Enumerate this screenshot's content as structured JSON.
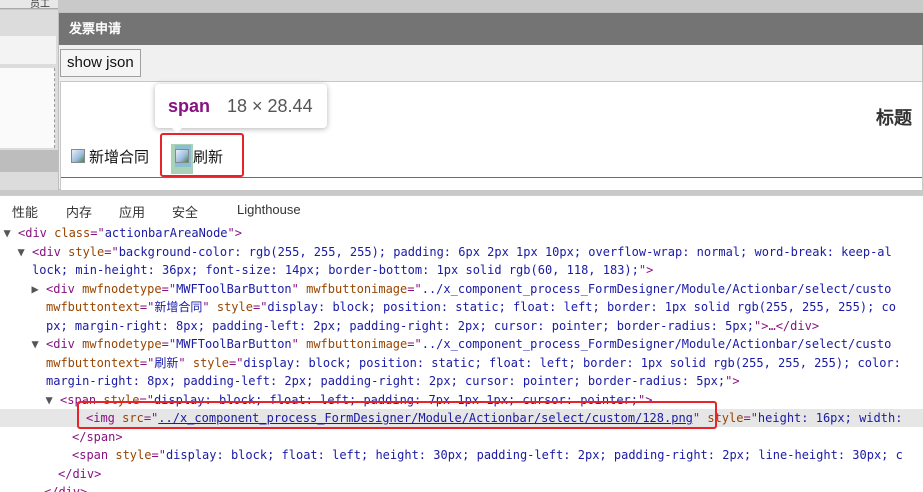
{
  "background": {
    "top_tab_label": "员工"
  },
  "dialog": {
    "title": "发票申请",
    "show_json_label": "show json",
    "form_title": "标题",
    "toolbar": {
      "add_contract_label": "新增合同",
      "refresh_label": "刷新"
    }
  },
  "tooltip": {
    "tag": "span",
    "size": "18 × 28.44"
  },
  "devtools": {
    "tabs": [
      "性能",
      "内存",
      "应用",
      "安全",
      "Lighthouse"
    ],
    "lines": [
      {
        "indent": 18,
        "tri": "▼",
        "parts": [
          [
            "tg",
            "<div "
          ],
          [
            "an",
            "class"
          ],
          [
            "tg",
            "=\""
          ],
          [
            "av",
            "actionbarAreaNode"
          ],
          [
            "tg",
            "\">"
          ]
        ]
      },
      {
        "indent": 32,
        "tri": "▼",
        "parts": [
          [
            "tg",
            "<div "
          ],
          [
            "an",
            "style"
          ],
          [
            "tg",
            "=\""
          ],
          [
            "av",
            "background-color: rgb(255, 255, 255); padding: 6px 2px 1px 10px; overflow-wrap: normal; word-break: keep-al"
          ]
        ]
      },
      {
        "indent": 32,
        "tri": "",
        "parts": [
          [
            "av",
            "lock; min-height: 36px; font-size: 14px; border-bottom: 1px solid rgb(60, 118, 183);"
          ],
          [
            "tg",
            "\">"
          ]
        ]
      },
      {
        "indent": 46,
        "tri": "▶",
        "parts": [
          [
            "tg",
            "<div "
          ],
          [
            "an",
            "mwfnodetype"
          ],
          [
            "tg",
            "=\""
          ],
          [
            "av",
            "MWFToolBarButton"
          ],
          [
            "tg",
            "\" "
          ],
          [
            "an",
            "mwfbuttonimage"
          ],
          [
            "tg",
            "=\""
          ],
          [
            "av",
            "../x_component_process_FormDesigner/Module/Actionbar/select/custo"
          ]
        ]
      },
      {
        "indent": 46,
        "tri": "",
        "parts": [
          [
            "an",
            "mwfbuttontext"
          ],
          [
            "tg",
            "=\""
          ],
          [
            "av",
            "新增合同"
          ],
          [
            "tg",
            "\" "
          ],
          [
            "an",
            "style"
          ],
          [
            "tg",
            "=\""
          ],
          [
            "av",
            "display: block; position: static; float: left; border: 1px solid rgb(255, 255, 255); co"
          ]
        ]
      },
      {
        "indent": 46,
        "tri": "",
        "parts": [
          [
            "av",
            "px; margin-right: 8px; padding-left: 2px; padding-right: 2px; cursor: pointer; border-radius: 5px;"
          ],
          [
            "tg",
            "\">…</div>"
          ]
        ]
      },
      {
        "indent": 46,
        "tri": "▼",
        "parts": [
          [
            "tg",
            "<div "
          ],
          [
            "an",
            "mwfnodetype"
          ],
          [
            "tg",
            "=\""
          ],
          [
            "av",
            "MWFToolBarButton"
          ],
          [
            "tg",
            "\" "
          ],
          [
            "an",
            "mwfbuttonimage"
          ],
          [
            "tg",
            "=\""
          ],
          [
            "av",
            "../x_component_process_FormDesigner/Module/Actionbar/select/custo"
          ]
        ]
      },
      {
        "indent": 46,
        "tri": "",
        "parts": [
          [
            "an",
            "mwfbuttontext"
          ],
          [
            "tg",
            "=\""
          ],
          [
            "av",
            "刷新"
          ],
          [
            "tg",
            "\" "
          ],
          [
            "an",
            "style"
          ],
          [
            "tg",
            "=\""
          ],
          [
            "av",
            "display: block; position: static; float: left; border: 1px solid rgb(255, 255, 255); color:"
          ]
        ]
      },
      {
        "indent": 46,
        "tri": "",
        "parts": [
          [
            "av",
            "margin-right: 8px; padding-left: 2px; padding-right: 2px; cursor: pointer; border-radius: 5px;"
          ],
          [
            "tg",
            "\">"
          ]
        ]
      },
      {
        "indent": 60,
        "tri": "▼",
        "parts": [
          [
            "tg",
            "<span "
          ],
          [
            "an",
            "style"
          ],
          [
            "tg",
            "=\""
          ],
          [
            "av",
            "display: block; float: left; padding: 7px 1px 1px; cursor: pointer;"
          ],
          [
            "tg",
            "\">"
          ]
        ]
      },
      {
        "indent": 86,
        "tri": "",
        "sel": true,
        "parts": [
          [
            "tg",
            "<img "
          ],
          [
            "an",
            "src"
          ],
          [
            "tg",
            "=\""
          ],
          [
            "lk",
            "../x_component_process_FormDesigner/Module/Actionbar/select/custom/128.png"
          ],
          [
            "tg",
            "\" "
          ],
          [
            "an",
            "style"
          ],
          [
            "tg",
            "=\""
          ],
          [
            "av",
            "height: 16px; width:"
          ]
        ]
      },
      {
        "indent": 72,
        "tri": "",
        "parts": [
          [
            "tg",
            "</span>"
          ]
        ]
      },
      {
        "indent": 72,
        "tri": "",
        "parts": [
          [
            "tg",
            "<span "
          ],
          [
            "an",
            "style"
          ],
          [
            "tg",
            "=\""
          ],
          [
            "av",
            "display: block; float: left; height: 30px; padding-left: 2px; padding-right: 2px; line-height: 30px; c"
          ]
        ]
      },
      {
        "indent": 58,
        "tri": "",
        "parts": [
          [
            "tg",
            "</div>"
          ]
        ]
      },
      {
        "indent": 44,
        "tri": "",
        "parts": [
          [
            "tg",
            "</div>"
          ]
        ]
      }
    ]
  }
}
